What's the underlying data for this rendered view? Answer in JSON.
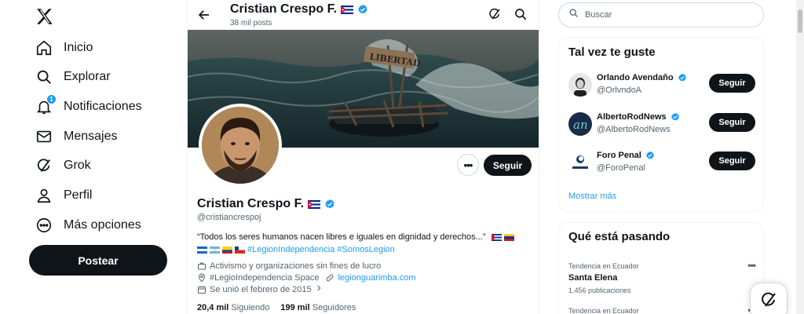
{
  "nav": {
    "items": [
      {
        "label": "Inicio",
        "icon": "home-icon"
      },
      {
        "label": "Explorar",
        "icon": "search-icon"
      },
      {
        "label": "Notificaciones",
        "icon": "bell-icon",
        "badge": "1"
      },
      {
        "label": "Mensajes",
        "icon": "mail-icon"
      },
      {
        "label": "Grok",
        "icon": "grok-icon"
      },
      {
        "label": "Perfil",
        "icon": "person-icon"
      },
      {
        "label": "Más opciones",
        "icon": "more-circle-icon"
      }
    ],
    "post_label": "Postear"
  },
  "header": {
    "name": "Cristian Crespo F.",
    "posts": "38 mil posts"
  },
  "banner": {
    "sign_text": "LIBERTAD"
  },
  "profile": {
    "name": "Cristian Crespo F.",
    "handle": "@cristiancrespoj",
    "bio_text": "“Todos los seres humanos nacen libres e iguales en dignidad y derechos...”",
    "hashtags": "#LegionIndependencia #SomosLegion",
    "category": "Activismo y organizaciones sin fines de lucro",
    "location": "#LegioIndependencia Space",
    "website": "legionguarimba.com",
    "joined": "Se unió el febrero de 2015",
    "following_count": "20,4 mil",
    "following_label": "Siguiendo",
    "followers_count": "199 mil",
    "followers_label": "Seguidores",
    "follow_label": "Seguir"
  },
  "search": {
    "placeholder": "Buscar"
  },
  "suggestions": {
    "title": "Tal vez te guste",
    "follow_label": "Seguir",
    "users": [
      {
        "name": "Orlando Avendaño",
        "handle": "@OrlvndoA"
      },
      {
        "name": "AlbertoRodNews",
        "handle": "@AlbertoRodNews"
      },
      {
        "name": "Foro Penal",
        "handle": "@ForoPenal"
      }
    ],
    "show_more": "Mostrar más"
  },
  "trends": {
    "title": "Qué está pasando",
    "items": [
      {
        "context": "Tendencia en Ecuador",
        "title": "Santa Elena",
        "count": "1.456 publicaciones"
      },
      {
        "context": "Tendencia en Ecuador",
        "title": "",
        "count": ""
      }
    ]
  },
  "colors": {
    "accent": "#1d9bf0",
    "text": "#0f1419",
    "muted": "#536471",
    "button_dark": "#0f1419"
  }
}
